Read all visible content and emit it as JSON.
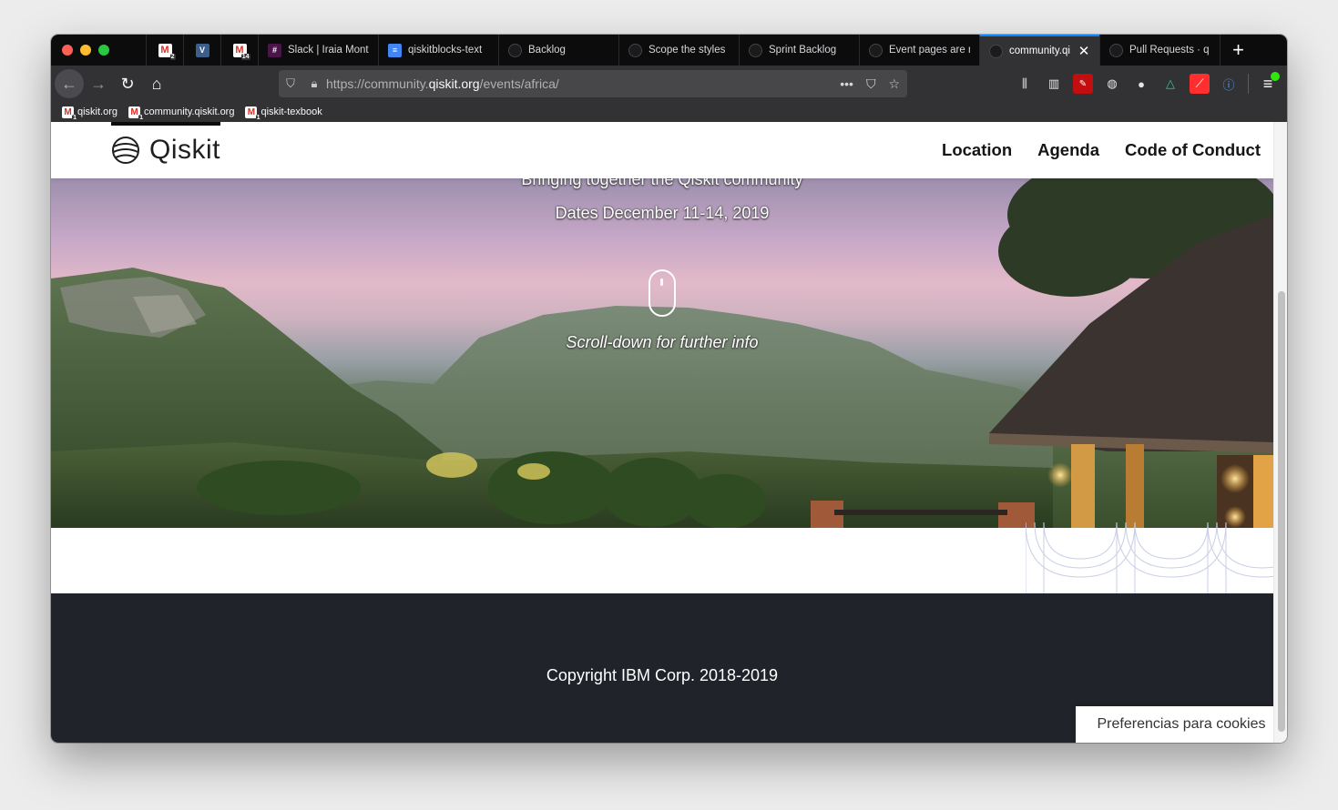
{
  "browser": {
    "tabs": [
      {
        "label": "",
        "icon": "gmail",
        "count": "2",
        "pinned": true
      },
      {
        "label": "",
        "icon": "v",
        "pinned": true
      },
      {
        "label": "",
        "icon": "gmail",
        "count": "14",
        "pinned": true
      },
      {
        "label": "Slack | Iraia Mont",
        "icon": "slack"
      },
      {
        "label": "qiskitblocks-text",
        "icon": "docs"
      },
      {
        "label": "Backlog",
        "icon": "github"
      },
      {
        "label": "Scope the styles",
        "icon": "github"
      },
      {
        "label": "Sprint Backlog",
        "icon": "github"
      },
      {
        "label": "Event pages are r",
        "icon": "github"
      },
      {
        "label": "community.qi",
        "icon": "qiskit",
        "active": true
      },
      {
        "label": "Pull Requests · q",
        "icon": "github"
      }
    ],
    "url": {
      "prefix": "https://community.",
      "host": "qiskit.org",
      "path": "/events/africa/"
    },
    "bookmarks": [
      {
        "label": "qiskit.org",
        "count": "1"
      },
      {
        "label": "community.qiskit.org",
        "count": "1"
      },
      {
        "label": "qiskit-texbook",
        "count": "1"
      }
    ]
  },
  "site": {
    "logo_text": "Qiskit",
    "nav": [
      "Location",
      "Agenda",
      "Code of Conduct"
    ],
    "hero": {
      "subtitle": "Bringing together the Qiskit community",
      "dates": "Dates December 11-14, 2019",
      "scroll_hint": "Scroll-down for further info"
    },
    "footer": {
      "copyright": "Copyright IBM Corp. 2018-2019"
    },
    "cookie_button": "Preferencias para cookies"
  }
}
